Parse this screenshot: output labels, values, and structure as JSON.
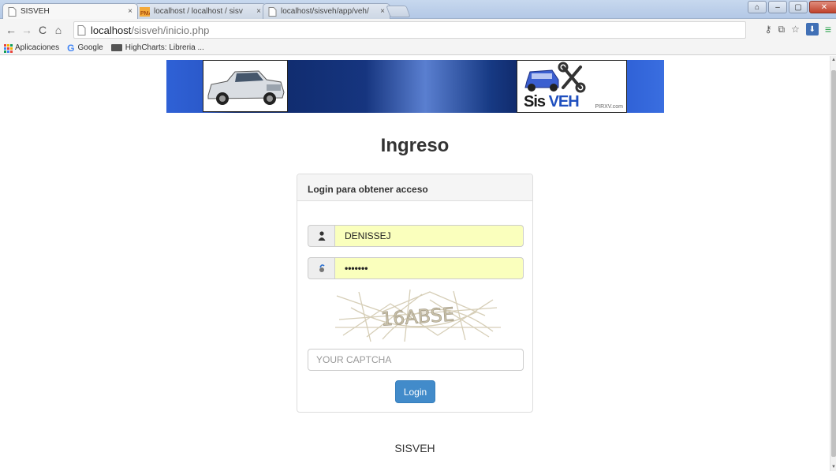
{
  "browser": {
    "tabs": [
      {
        "title": "SISVEH",
        "active": true
      },
      {
        "title": "localhost / localhost / sisv",
        "active": false
      },
      {
        "title": "localhost/sisveh/app/veh/",
        "active": false
      }
    ],
    "tab_close": "×",
    "url_host": "localhost",
    "url_path": "/sisveh/inicio.php",
    "bookmarks": [
      "Aplicaciones",
      "Google",
      "HighCharts: Libreria ..."
    ]
  },
  "banner": {
    "logo_text_a": "Sis ",
    "logo_text_b": "VEH",
    "logo_sub": "PIRXV.com"
  },
  "page": {
    "title": "Ingreso",
    "panel_heading": "Login para obtener acceso",
    "username_value": "DENISSEJ",
    "password_value": "•••••••",
    "captcha_text": "16ABSE",
    "captcha_placeholder": "YOUR CAPTCHA",
    "login_button": "Login",
    "footer": "SISVEH"
  },
  "colors": {
    "primary": "#428bca",
    "autofill": "#faffbd",
    "banner_blue": "#2f61d6"
  }
}
